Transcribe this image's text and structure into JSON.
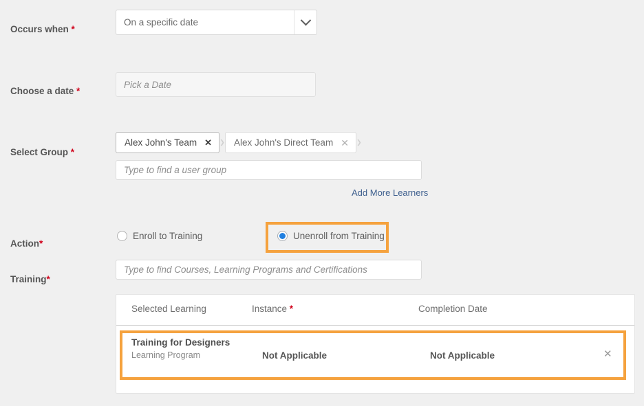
{
  "theme": {
    "page_bg": "#f0f0f0",
    "highlight": "#f5a23e",
    "radio_selected": "#1f7fe0",
    "link": "#40618f",
    "required_asterisk": "#d0021b"
  },
  "fields": {
    "occurs_when": {
      "label": "Occurs when ",
      "required_mark": "*",
      "select_value": "On a specific date",
      "chevron_icon": "chevron-down-icon"
    },
    "choose_date": {
      "label": "Choose a date ",
      "required_mark": "*",
      "placeholder": "Pick a Date",
      "value": ""
    },
    "select_group": {
      "label": "Select Group ",
      "required_mark": "*",
      "chips": [
        {
          "text": "Alex John's Team",
          "remove_icon": "✕",
          "style": "primary"
        },
        {
          "text": "Alex John's Direct Team",
          "remove_icon": "✕",
          "style": "secondary"
        }
      ],
      "chip_separator": "❯",
      "placeholder": "Type to find a user group",
      "value": "",
      "add_more_link": "Add More Learners"
    },
    "action": {
      "label": "Action",
      "required_mark": "*",
      "options": [
        {
          "label": "Enroll to Training",
          "selected": false,
          "highlighted": false
        },
        {
          "label": "Unenroll from Training",
          "selected": true,
          "highlighted": true
        }
      ]
    },
    "training": {
      "label": "Training",
      "required_mark": "*",
      "placeholder": "Type to find Courses, Learning Programs and Certifications",
      "value": ""
    }
  },
  "table": {
    "columns": [
      {
        "label": "Selected Learning",
        "required_mark": ""
      },
      {
        "label": "Instance ",
        "required_mark": "*"
      },
      {
        "label": "Completion Date",
        "required_mark": ""
      }
    ],
    "rows": [
      {
        "name": "Training for Designers",
        "type": "Learning Program",
        "instance": "Not Applicable",
        "completion_date": "Not Applicable",
        "remove_icon": "✕",
        "highlighted": true
      }
    ]
  }
}
